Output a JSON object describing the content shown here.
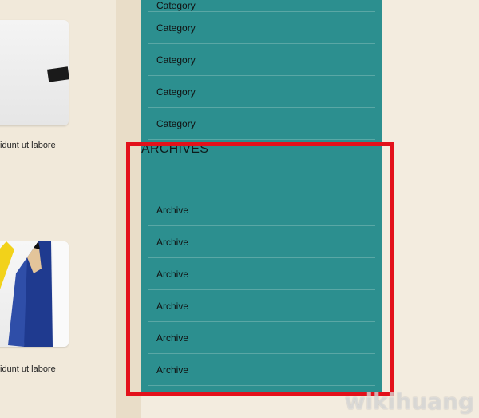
{
  "left_posts": {
    "excerpt_1": "idunt ut labore",
    "excerpt_2": "idunt ut labore"
  },
  "sidebar": {
    "categories": [
      "Category",
      "Category",
      "Category",
      "Category",
      "Category"
    ],
    "archives_heading": "ARCHIVES",
    "archives": [
      "Archive",
      "Archive",
      "Archive",
      "Archive",
      "Archive",
      "Archive"
    ]
  },
  "watermark": "wikihuang",
  "colors": {
    "sidebar": "#2c8f8f",
    "page_bg": "#f3ecdf",
    "highlight": "#e3111b"
  }
}
